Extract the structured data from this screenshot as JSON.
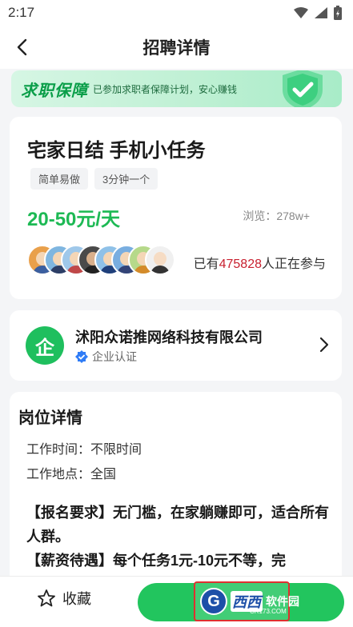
{
  "status_bar": {
    "time": "2:17"
  },
  "header": {
    "title": "招聘详情"
  },
  "banner": {
    "title": "求职保障",
    "subtitle": "已参加求职者保障计划，安心赚钱"
  },
  "job": {
    "title": "宅家日结 手机小任务",
    "tags": [
      "简单易做",
      "3分钟一个"
    ],
    "salary": "20-50元/天",
    "views_label": "浏览：",
    "views_value": "278w+",
    "participants_prefix": "已有",
    "participants_count": "475828",
    "participants_suffix": "人正在参与"
  },
  "company": {
    "logo_char": "企",
    "name": "沭阳众诺推网络科技有限公司",
    "verify_label": "企业认证"
  },
  "details": {
    "title": "岗位详情",
    "work_time": "工作时间：不限时间",
    "work_place": "工作地点：全国",
    "requirement": "【报名要求】无门槛，在家躺赚即可，适合所有人群。",
    "salary_line": "【薪资待遇】每个任务1元-10元不等，完"
  },
  "bottom": {
    "favorite_label": "收藏"
  },
  "watermark": {
    "text": "西西",
    "brand": "软件园",
    "url": "CR173.COM"
  },
  "colors": {
    "accent_green": "#22c55e",
    "salary_green": "#1db954",
    "highlight_red": "#c8202f"
  }
}
